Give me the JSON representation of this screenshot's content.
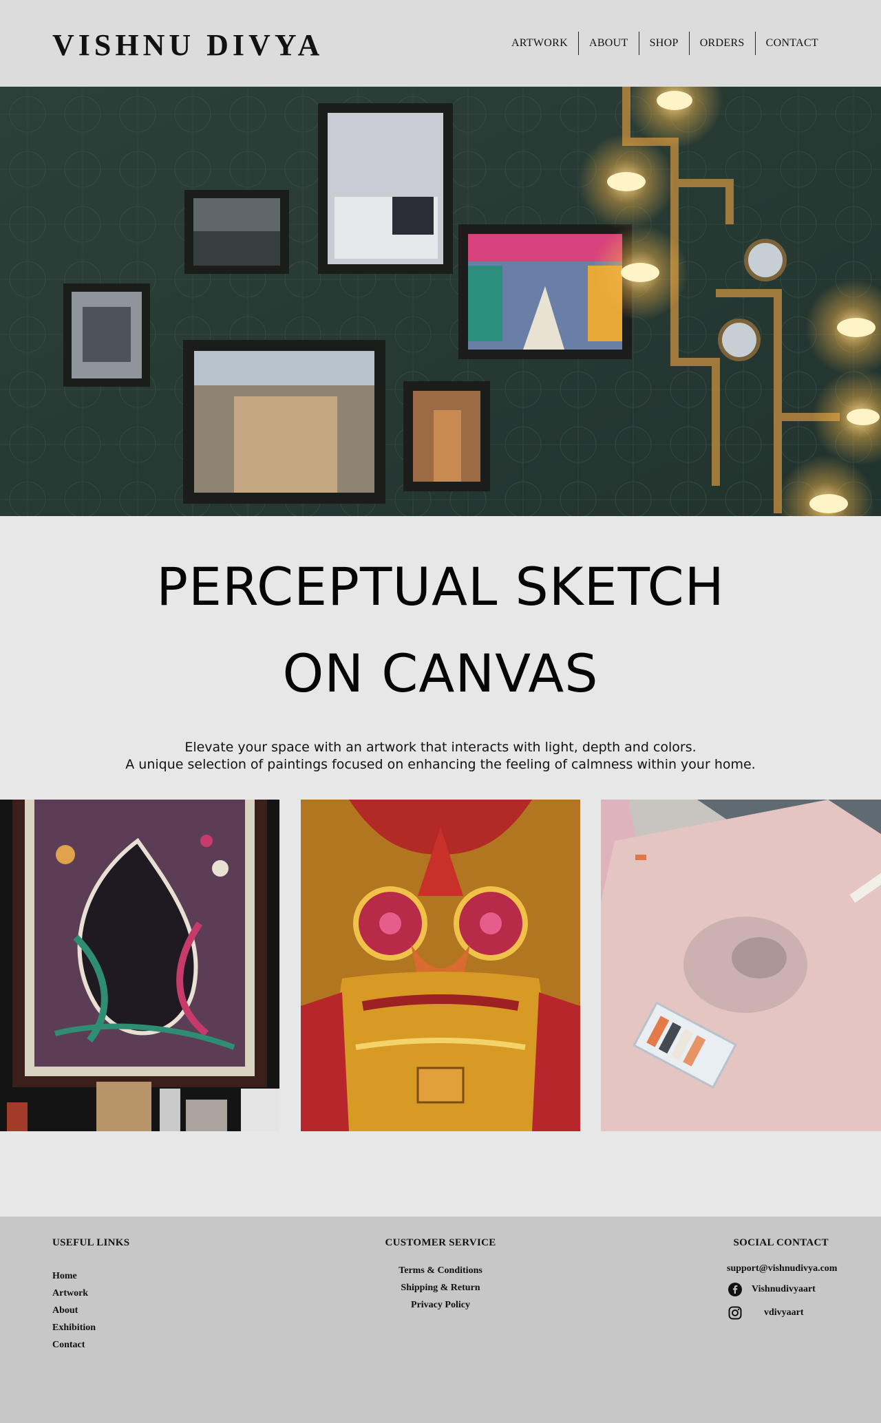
{
  "header": {
    "brand": "VISHNU DIVYA",
    "nav": [
      "ARTWORK",
      "ABOUT",
      "SHOP",
      "ORDERS",
      "CONTACT"
    ]
  },
  "main": {
    "headline_line1": "PERCEPTUAL SKETCH",
    "headline_line2": "ON CANVAS",
    "subtext_line1": "Elevate your space with an artwork that interacts with light, depth and colors.",
    "subtext_line2": "A unique selection of paintings focused on enhancing the feeling of calmness within your home."
  },
  "footer": {
    "useful_links_title": "USEFUL LINKS",
    "useful_links": [
      "Home",
      "Artwork",
      "About",
      "Exhibition",
      "Contact"
    ],
    "customer_service_title": "CUSTOMER SERVICE",
    "customer_service_links": [
      "Terms & Conditions",
      "Shipping & Return",
      "Privacy Policy"
    ],
    "social_title": "SOCIAL CONTACT",
    "email": "support@vishnudivya.com",
    "facebook": "Vishnudivyaart",
    "instagram": "vdivyaart"
  },
  "colors": {
    "header_bg": "#dcdcdc",
    "page_bg": "#e7e7e7",
    "footer_bg": "#c8c7c8",
    "hero_wall": "#2a3c36"
  },
  "icons": [
    "facebook-icon",
    "instagram-icon"
  ]
}
